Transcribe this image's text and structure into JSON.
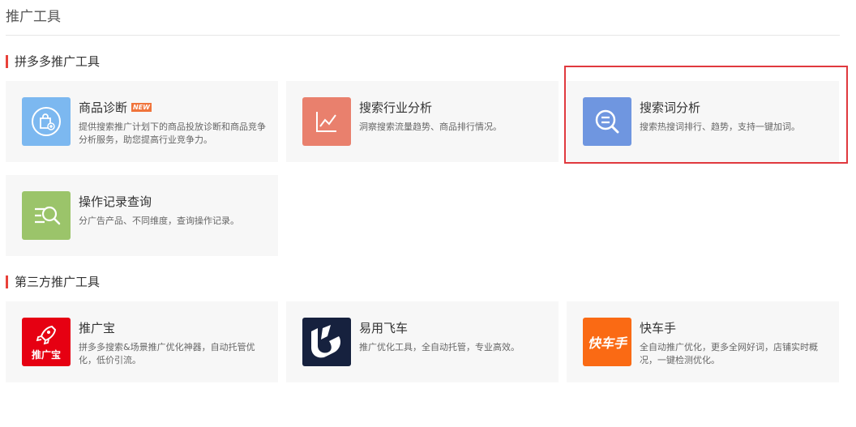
{
  "page": {
    "title": "推广工具"
  },
  "sections": [
    {
      "title": "拼多多推广工具"
    },
    {
      "title": "第三方推广工具"
    }
  ],
  "tools": [
    {
      "name": "商品诊断",
      "badge": "NEW",
      "desc": "提供搜索推广计划下的商品投放诊断和商品竞争分析服务，助您提高行业竞争力。",
      "icon": "bag-plus-icon",
      "color": "#7cb8f0"
    },
    {
      "name": "搜索行业分析",
      "desc": "洞察搜索流量趋势、商品排行情况。",
      "icon": "line-chart-icon",
      "color": "#e9806d"
    },
    {
      "name": "搜索词分析",
      "desc": "搜索热搜词排行、趋势，支持一键加词。",
      "icon": "search-list-icon",
      "color": "#6f96e0"
    },
    {
      "name": "操作记录查询",
      "desc": "分广告产品、不同维度，查询操作记录。",
      "icon": "record-search-icon",
      "color": "#9bc46a"
    }
  ],
  "third_party": [
    {
      "name": "推广宝",
      "desc": "拼多多搜索&场景推广优化神器，自动托管优化，低价引流。",
      "icon": "rocket-icon",
      "logo_text": "推广宝",
      "color": "#e60012"
    },
    {
      "name": "易用飞车",
      "desc": "推广优化工具，全自动托管，专业高效。",
      "icon": "yiyong-logo-icon",
      "color": "#16213e"
    },
    {
      "name": "快车手",
      "desc": "全自动推广优化，更多全网好词，店铺实时概况，一键检测优化。",
      "icon": "kuaicheshou-logo-icon",
      "logo_text": "快车手",
      "color": "#fa6a14"
    }
  ]
}
